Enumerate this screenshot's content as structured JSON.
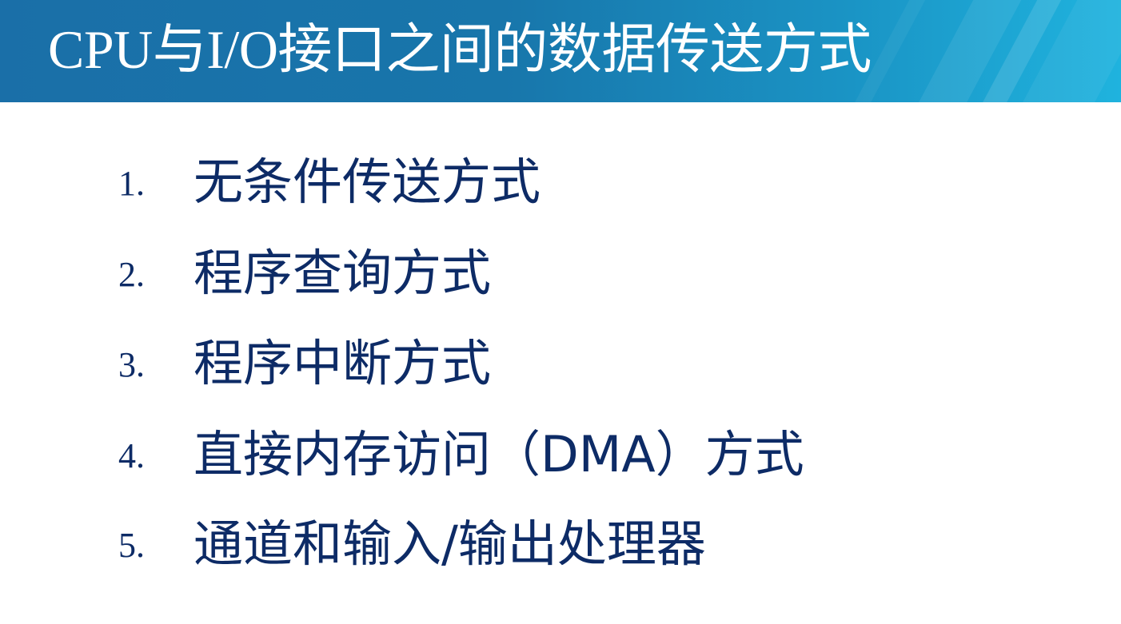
{
  "slide": {
    "title": "CPU与I/O接口之间的数据传送方式",
    "items": [
      {
        "number": "1.",
        "text": "无条件传送方式"
      },
      {
        "number": "2.",
        "text": "程序查询方式"
      },
      {
        "number": "3.",
        "text": "程序中断方式"
      },
      {
        "number": "4.",
        "text": "直接内存访问（DMA）方式"
      },
      {
        "number": "5.",
        "text": "通道和输入/输出处理器"
      }
    ]
  },
  "colors": {
    "header_start": "#1a6fa8",
    "header_end": "#1fb3de",
    "title_text": "#ffffff",
    "body_text": "#0d2b66"
  }
}
